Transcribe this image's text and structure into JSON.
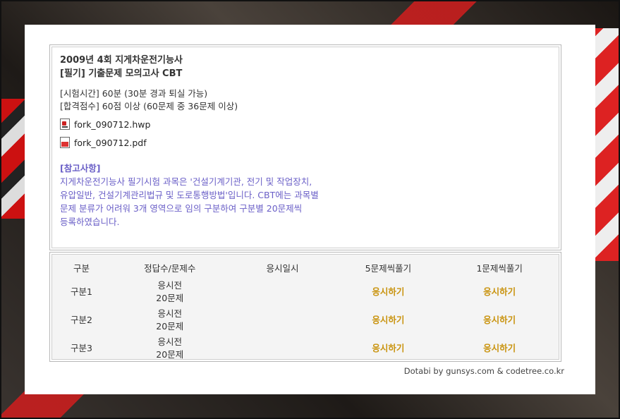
{
  "exam": {
    "title_line1": "2009년 4회 지게차운전기능사",
    "title_line2": "[필기] 기출문제 모의고사 CBT",
    "time": "[시험시간] 60분 (30분 경과 퇴실 가능)",
    "pass": "[합격점수] 60점 이상 (60문제 중 36문제 이상)"
  },
  "files": [
    {
      "name": "fork_090712.hwp",
      "icon": "hwp-file-icon"
    },
    {
      "name": "fork_090712.pdf",
      "icon": "pdf-file-icon"
    }
  ],
  "note": {
    "title": "[참고사항]",
    "body": "지게차운전기능사 필기시험 과목은 '건설기계기관, 전기 및 작업장치, 유압일반, 건설기계관리법규 및 도로통행방법'입니다. CBT에는 과목별 문제 분류가 어려워 3개 영역으로 임의 구분하여 구분별 20문제씩 등록하였습니다."
  },
  "table": {
    "headers": [
      "구분",
      "정답수/문제수",
      "응시일시",
      "5문제씩풀기",
      "1문제씩풀기"
    ],
    "rows": [
      {
        "section": "구분1",
        "status": "응시전",
        "count": "20문제",
        "date": "",
        "five": "응시하기",
        "one": "응시하기"
      },
      {
        "section": "구분2",
        "status": "응시전",
        "count": "20문제",
        "date": "",
        "five": "응시하기",
        "one": "응시하기"
      },
      {
        "section": "구분3",
        "status": "응시전",
        "count": "20문제",
        "date": "",
        "five": "응시하기",
        "one": "응시하기"
      }
    ]
  },
  "credit": "Dotabi by gunsys.com & codetree.co.kr",
  "colors": {
    "note": "#6a5fc7",
    "start_button": "#c9930e"
  }
}
